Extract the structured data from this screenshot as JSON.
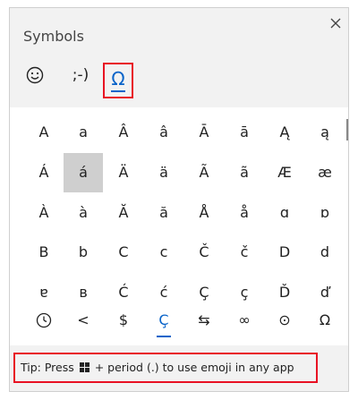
{
  "window": {
    "title": "Symbols"
  },
  "tabs": [
    {
      "name": "emoji",
      "icon": "smiley-icon"
    },
    {
      "name": "kaomoji",
      "label": ";-)"
    },
    {
      "name": "symbols",
      "label": "Ω",
      "active": true
    }
  ],
  "symbols": {
    "rows": [
      [
        "A",
        "a",
        "Â",
        "â",
        "Ā",
        "ā",
        "Ą",
        "ą"
      ],
      [
        "Á",
        "á",
        "Ä",
        "ä",
        "Ã",
        "ã",
        "Æ",
        "æ"
      ],
      [
        "À",
        "à",
        "Ă",
        "ă",
        "Å",
        "å",
        "ɑ",
        "ɒ"
      ],
      [
        "B",
        "b",
        "C",
        "c",
        "Č",
        "č",
        "D",
        "d"
      ],
      [
        "ɐ",
        "ʙ",
        "Ć",
        "ć",
        "Ç",
        "ç",
        "Ď",
        "ď"
      ]
    ],
    "selected": {
      "row": 1,
      "col": 1
    }
  },
  "categories": [
    {
      "name": "history",
      "icon": "clock-icon"
    },
    {
      "name": "punctuation",
      "label": "<"
    },
    {
      "name": "currency",
      "label": "$"
    },
    {
      "name": "latin",
      "label": "Ç",
      "active": true
    },
    {
      "name": "geometric",
      "label": "⇆"
    },
    {
      "name": "math",
      "label": "∞"
    },
    {
      "name": "supplemental",
      "label": "⊙"
    },
    {
      "name": "language",
      "label": "Ω"
    }
  ],
  "tip": {
    "prefix": "Tip: Press",
    "suffix": "+ period (.) to use emoji in any app"
  },
  "colors": {
    "accent": "#0a64c9",
    "highlight": "#e81123",
    "selected_bg": "#cfcfcf"
  }
}
